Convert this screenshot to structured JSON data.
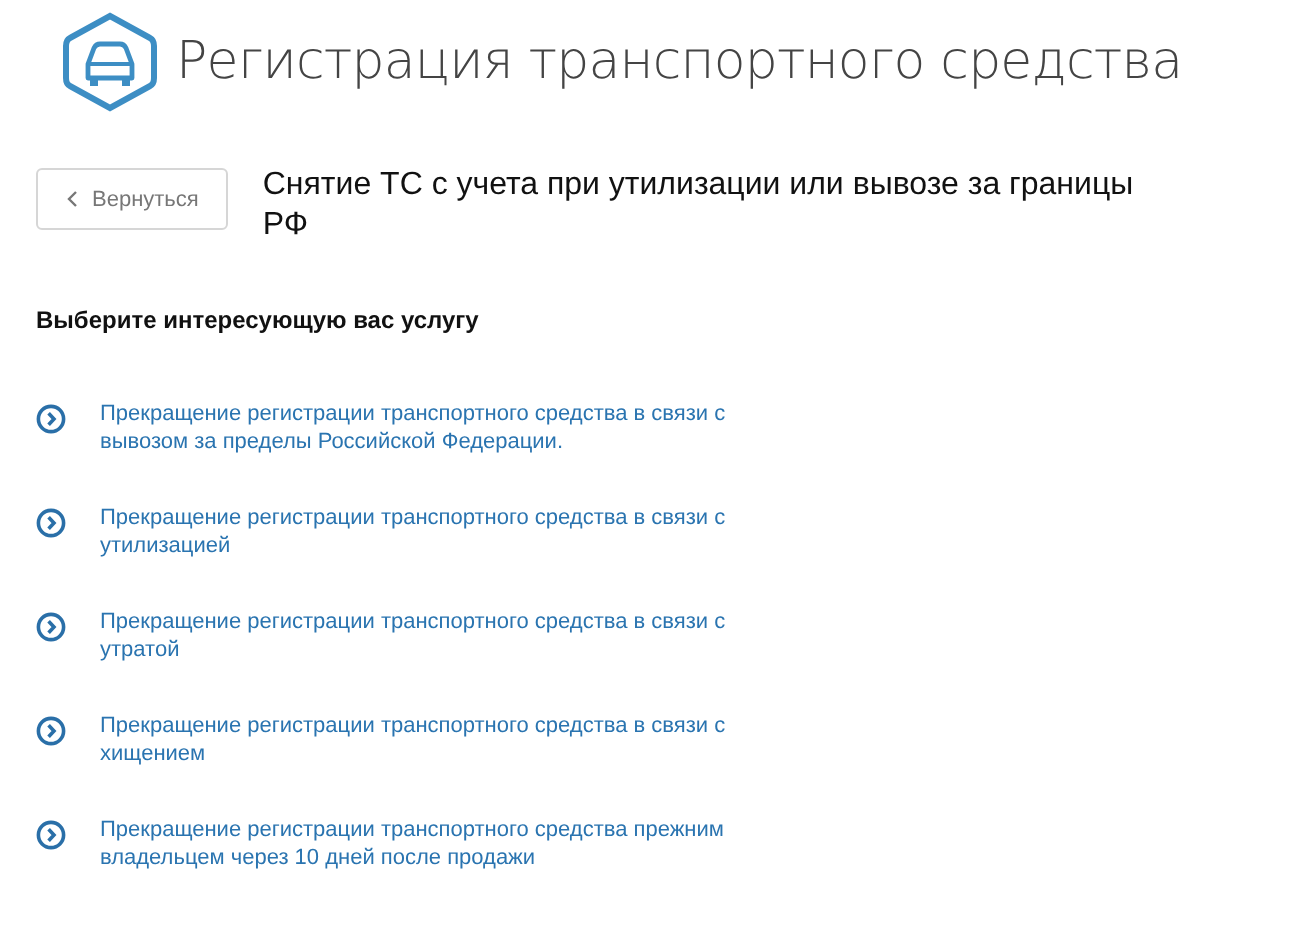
{
  "header": {
    "title": "Регистрация транспортного средства"
  },
  "back_button": {
    "label": "Вернуться"
  },
  "page_title": "Снятие ТС с учета при утилизации или вывозе за границы РФ",
  "section_title": "Выберите интересующую вас услугу",
  "services": [
    {
      "label": "Прекращение регистрации транспортного средства в связи с вывозом за пределы Российской Федерации."
    },
    {
      "label": "Прекращение регистрации транспортного средства в связи с утилизацией"
    },
    {
      "label": "Прекращение регистрации транспортного средства в связи с утратой"
    },
    {
      "label": "Прекращение регистрации транспортного средства в связи с хищением"
    },
    {
      "label": "Прекращение регистрации транспортного средства прежним владельцем через 10 дней после продажи"
    }
  ]
}
